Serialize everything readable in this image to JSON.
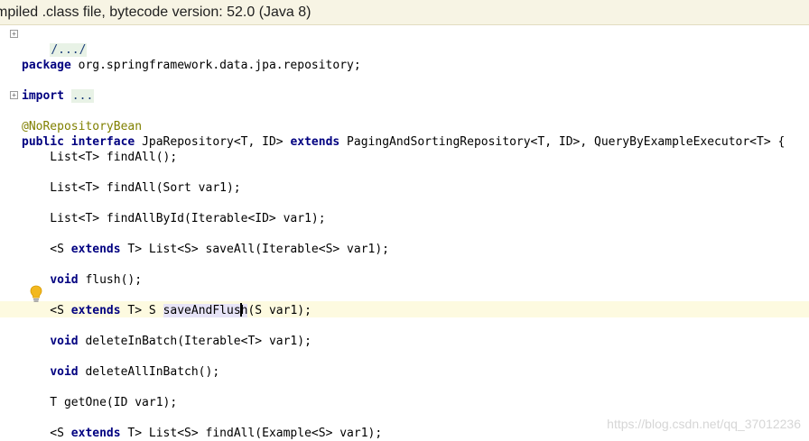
{
  "banner": {
    "text": "mpiled .class file, bytecode version: 52.0 (Java 8)"
  },
  "editor": {
    "l1_folded": "/.../",
    "l2_kw": "package",
    "l2_rest": " org.springframework.data.jpa.repository;",
    "l3_kw": "import",
    "l3_folded": "...",
    "l4_annotation": "@NoRepositoryBean",
    "l5_kw1": "public",
    "l5_kw2": "interface",
    "l5_mid": " JpaRepository<T, ID> ",
    "l5_kw3": "extends",
    "l5_rest": " PagingAndSortingRepository<T, ID>, QueryByExampleExecutor<T> {",
    "l6": "    List<T> findAll();",
    "l7": "    List<T> findAll(Sort var1);",
    "l8": "    List<T> findAllById(Iterable<ID> var1);",
    "l9_pre": "    <S ",
    "l9_kw": "extends",
    "l9_rest": " T> List<S> saveAll(Iterable<S> var1);",
    "l10_pre": "    ",
    "l10_kw": "void",
    "l10_rest": " flush();",
    "l11_pre": "    <S ",
    "l11_kw": "extends",
    "l11_mid": " T> S ",
    "l11_sel_a": "saveAndFlus",
    "l11_sel_b": "h",
    "l11_rest": "(S var1);",
    "l12_pre": "    ",
    "l12_kw": "void",
    "l12_rest": " deleteInBatch(Iterable<T> var1);",
    "l13_pre": "    ",
    "l13_kw": "void",
    "l13_rest": " deleteAllInBatch();",
    "l14": "    T getOne(ID var1);",
    "l15_pre": "    <S ",
    "l15_kw": "extends",
    "l15_rest": " T> List<S> findAll(Example<S> var1);"
  },
  "watermark": {
    "text": "https://blog.csdn.net/qq_37012236"
  },
  "icons": {
    "intention": "lightbulb-icon",
    "fold": "fold-marker-icon"
  },
  "colors": {
    "keyword": "#000080",
    "annotation": "#808000",
    "banner_bg": "#f7f4e4",
    "current_line": "#fdfae0"
  }
}
